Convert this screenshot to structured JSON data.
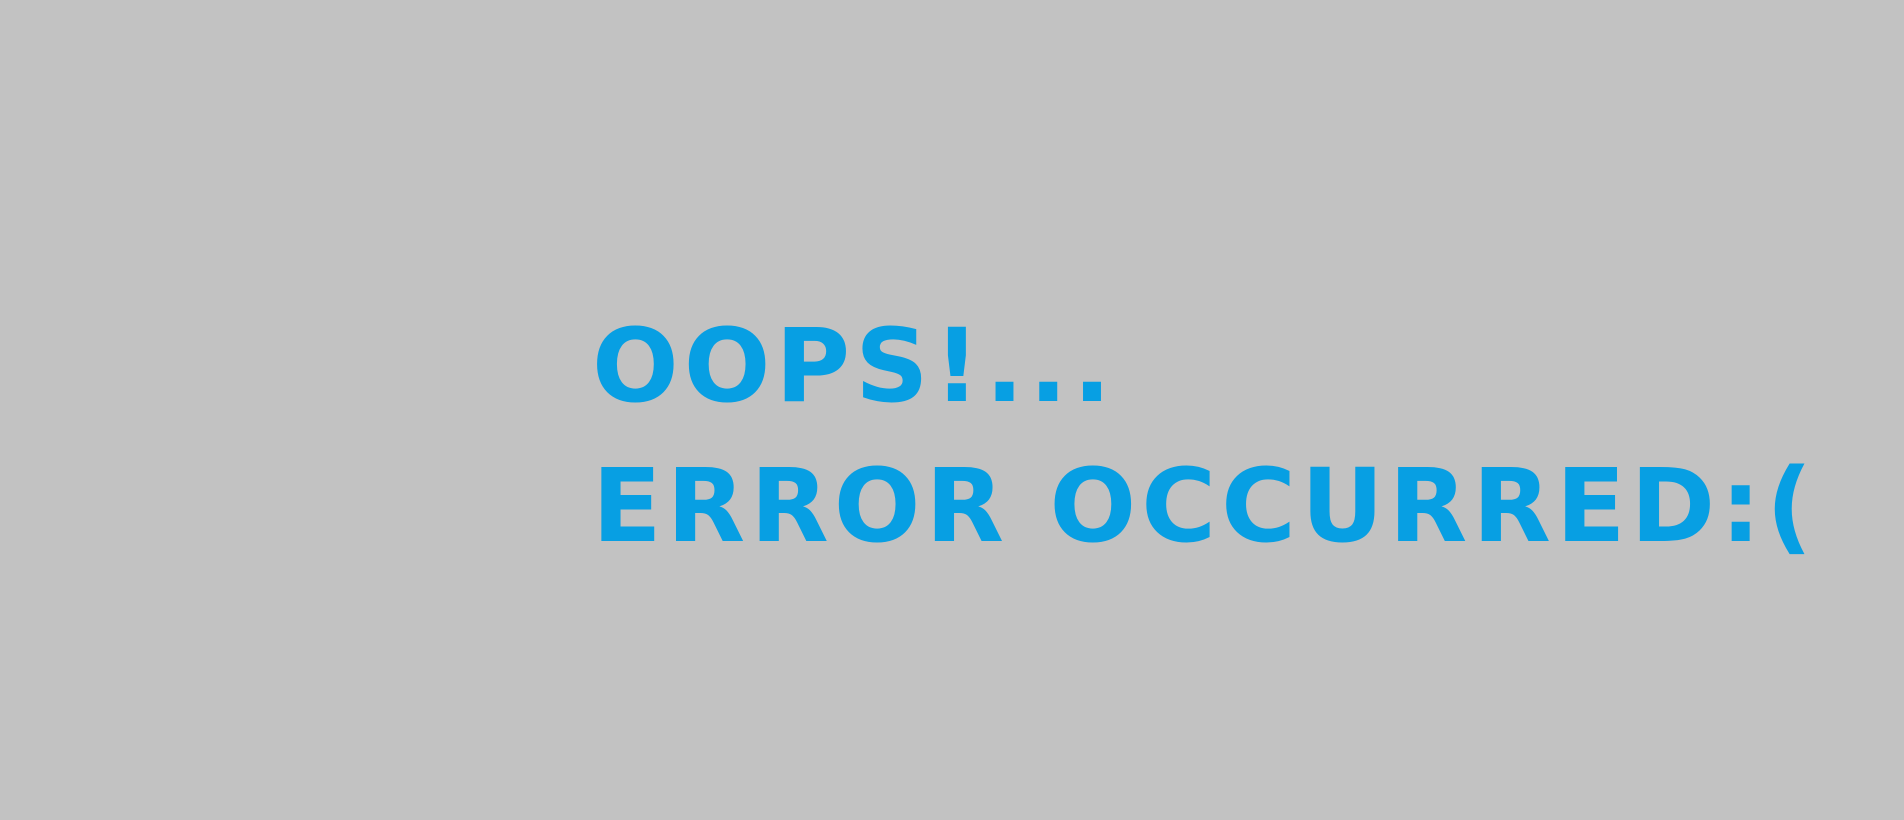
{
  "error_page": {
    "headline": "OOPS!...",
    "message": "ERROR OCCURRED:("
  },
  "colors": {
    "background": "#c2c2c2",
    "text": "#079fe3"
  }
}
